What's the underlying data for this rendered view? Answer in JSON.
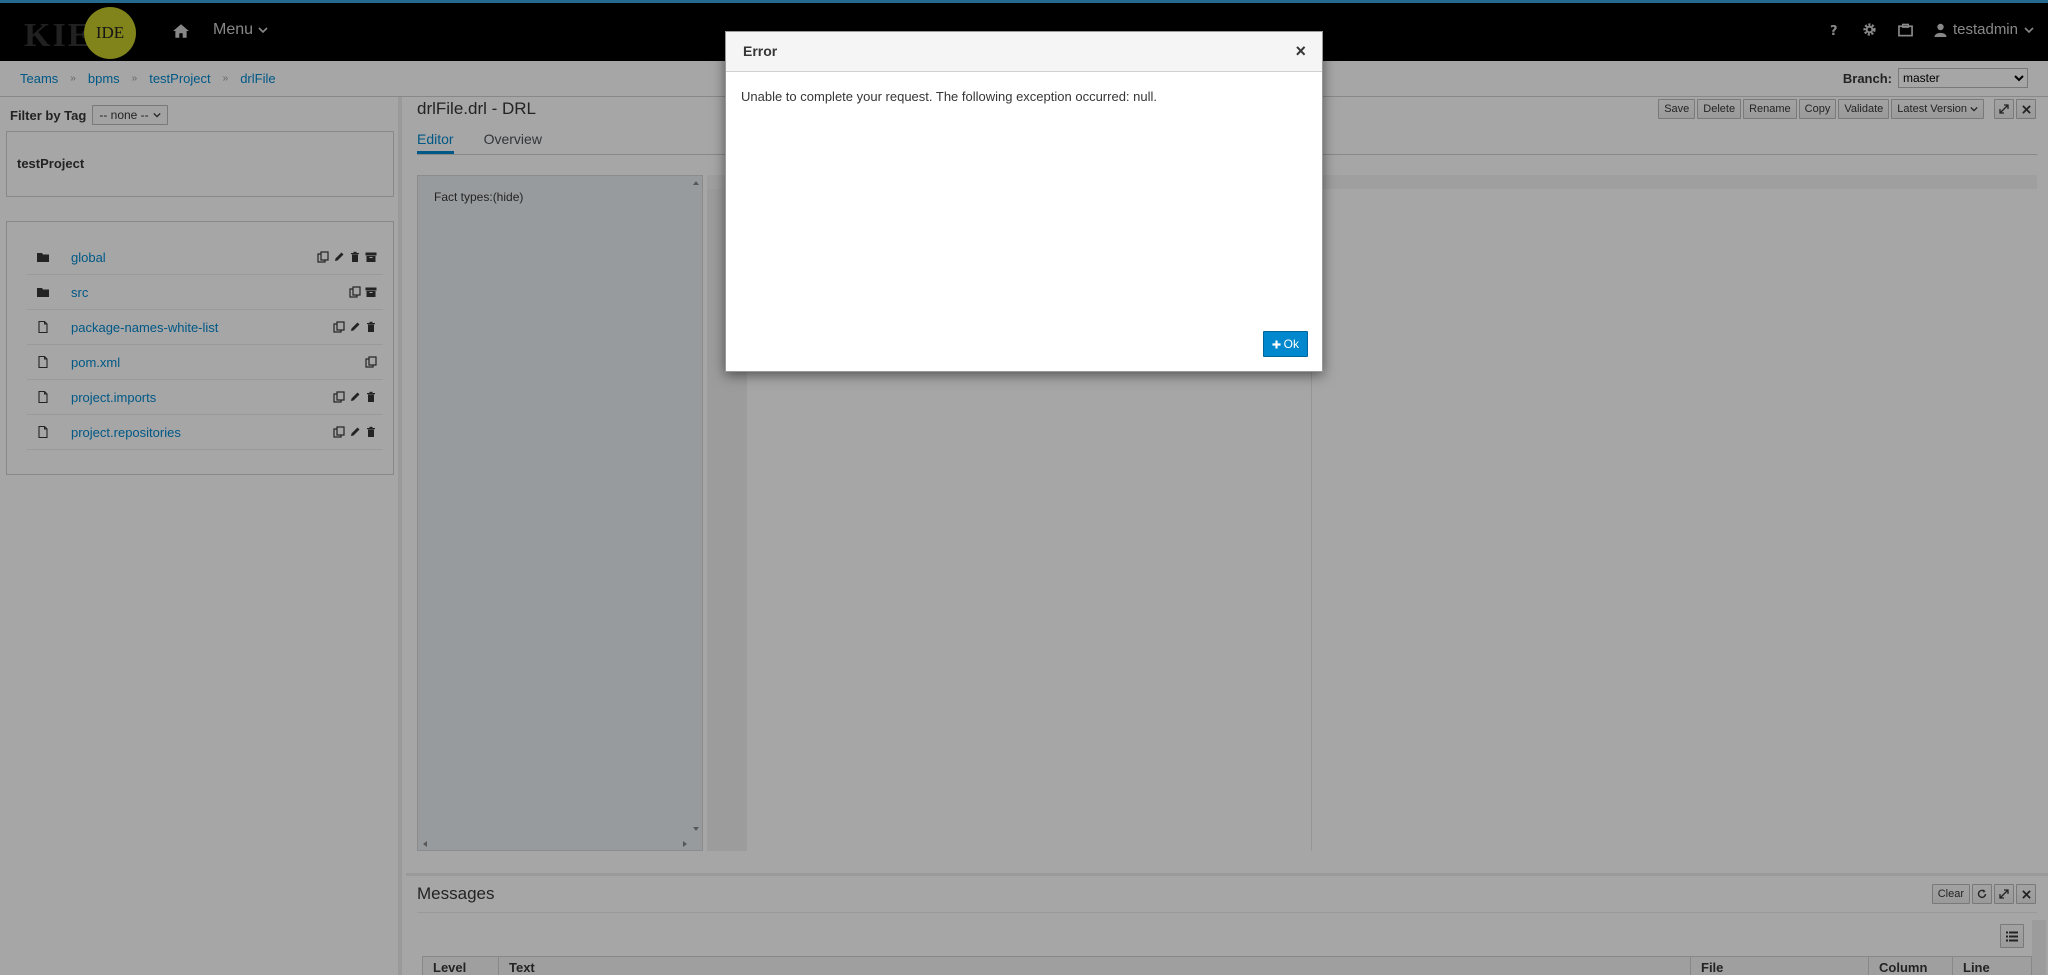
{
  "navbar": {
    "logo_text": "KIE",
    "logo_badge": "IDE",
    "menu_label": "Menu",
    "user_label": "testadmin"
  },
  "breadcrumb": {
    "items": [
      "Teams",
      "bpms",
      "testProject",
      "drlFile"
    ]
  },
  "branch": {
    "label": "Branch:",
    "value": "master"
  },
  "sidebar": {
    "filter_label": "Filter by Tag",
    "filter_value": "-- none --",
    "project_name": "testProject",
    "files": [
      {
        "name": "global",
        "type": "folder"
      },
      {
        "name": "src",
        "type": "folder"
      },
      {
        "name": "package-names-white-list",
        "type": "file"
      },
      {
        "name": "pom.xml",
        "type": "file"
      },
      {
        "name": "project.imports",
        "type": "file"
      },
      {
        "name": "project.repositories",
        "type": "file"
      }
    ]
  },
  "editor": {
    "title": "drlFile.drl - DRL",
    "toolbar": {
      "save": "Save",
      "delete": "Delete",
      "rename": "Rename",
      "copy": "Copy",
      "validate": "Validate",
      "latest_version": "Latest Version"
    },
    "tabs": [
      "Editor",
      "Overview"
    ],
    "fact_types_label": "Fact types:(hide)"
  },
  "messages": {
    "title": "Messages",
    "clear": "Clear",
    "columns": [
      "Level",
      "Text",
      "File",
      "Column",
      "Line"
    ]
  },
  "dialog": {
    "title": "Error",
    "close": "×",
    "message": "Unable to complete your request. The following exception occurred: null.",
    "ok": "Ok"
  },
  "colors": {
    "accent": "#0088ce",
    "logo_badge": "#c6c92a",
    "navbar": "#000000"
  }
}
